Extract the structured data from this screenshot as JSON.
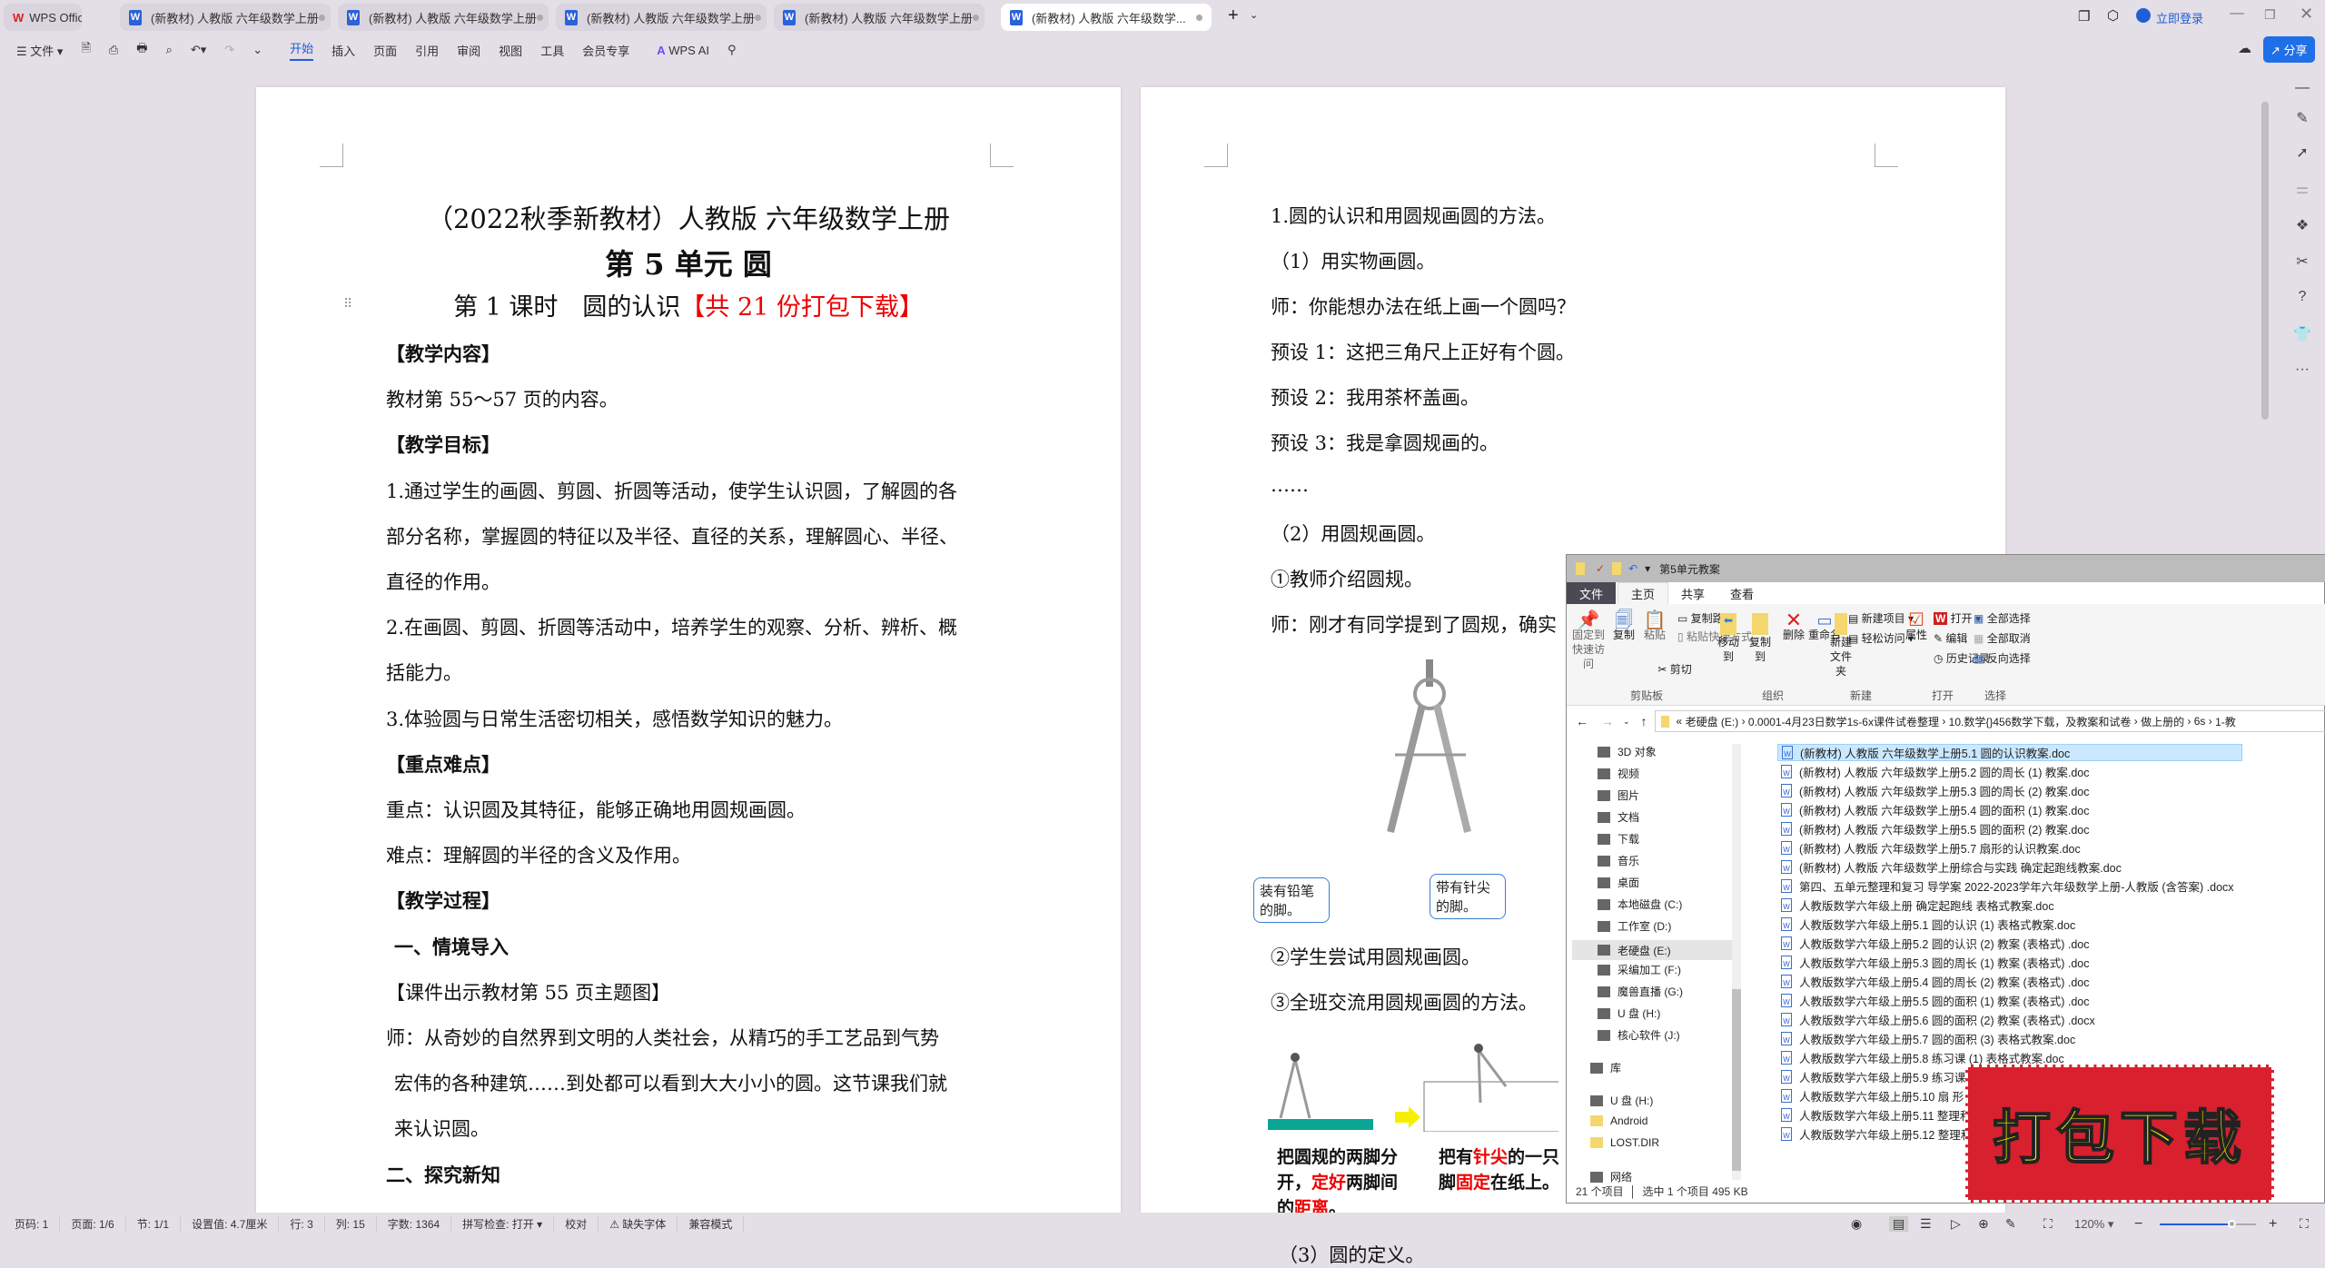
{
  "app": {
    "name": "WPS Office",
    "login": "立即登录",
    "share": "分享",
    "accent": "#1f5fd6"
  },
  "tabs": [
    {
      "label": "(新教材) 人教版 六年级数学上册"
    },
    {
      "label": "(新教材) 人教版 六年级数学上册"
    },
    {
      "label": "(新教材) 人教版 六年级数学上册"
    },
    {
      "label": "(新教材) 人教版 六年级数学上册"
    },
    {
      "label": "(新教材) 人教版 六年级数学..."
    }
  ],
  "toolbar": {
    "file": "文件",
    "menus": [
      "开始",
      "插入",
      "页面",
      "引用",
      "审阅",
      "视图",
      "工具",
      "会员专享"
    ],
    "ai": "WPS AI",
    "active": "开始"
  },
  "page1": {
    "title1": "（2022秋季新教材）人教版 六年级数学上册",
    "title2": "第 5 单元  圆",
    "title3a": "第 1 课时　圆的认识",
    "title3b": "【共 21 份打包下载】",
    "lines": [
      "【教学内容】",
      "教材第 55～57 页的内容。",
      "【教学目标】",
      "1.通过学生的画圆、剪圆、折圆等活动，使学生认识圆，了解圆的各",
      "部分名称，掌握圆的特征以及半径、直径的关系，理解圆心、半径、",
      "直径的作用。",
      "2.在画圆、剪圆、折圆等活动中，培养学生的观察、分析、辨析、概",
      "括能力。",
      "3.体验圆与日常生活密切相关，感悟数学知识的魅力。",
      "【重点难点】",
      "重点：认识圆及其特征，能够正确地用圆规画圆。",
      "难点：理解圆的半径的含义及作用。",
      "【教学过程】",
      "一、情境导入",
      "【课件出示教材第 55 页主题图】",
      "师：从奇妙的自然界到文明的人类社会，从精巧的手工艺品到气势",
      "宏伟的各种建筑……到处都可以看到大大小小的圆。这节课我们就",
      "来认识圆。",
      "二、探究新知"
    ]
  },
  "page2": {
    "lines": [
      "1.圆的认识和用圆规画圆的方法。",
      "（1）用实物画圆。",
      "师：你能想办法在纸上画一个圆吗？",
      "预设 1：这把三角尺上正好有个圆。",
      "预设 2：我用茶杯盖画。",
      "预设 3：我是拿圆规画的。",
      "……",
      "（2）用圆规画圆。",
      "①教师介绍圆规。",
      "师：刚才有同学提到了圆规，确实"
    ],
    "callout_left": "装有铅笔的脚。",
    "callout_right": "带有针尖的脚。",
    "step2": "②学生尝试用圆规画圆。",
    "step3": "③全班交流用圆规画圆的方法。",
    "cap1a": "把圆规的两脚分",
    "cap1b": "开，",
    "cap1c": "定好",
    "cap1d": "两脚间",
    "cap1e": "的",
    "cap1f": "距离",
    "cap1g": "。",
    "cap2a": "把有",
    "cap2b": "针尖",
    "cap2c": "的一只",
    "cap2d": "脚",
    "cap2e": "固定",
    "cap2f": "在纸上。",
    "def": "（3）圆的定义。"
  },
  "explorer": {
    "title": "第5单元教案",
    "tabs": [
      "文件",
      "主页",
      "共享",
      "查看"
    ],
    "ribbon": {
      "pin": "固定到快速访问",
      "copy": "复制",
      "paste": "粘贴",
      "copy_path": "复制路径",
      "paste_shortcut": "粘贴快捷方式",
      "cut": "剪切",
      "clipboard": "剪贴板",
      "move_to": "移动到",
      "copy_to": "复制到",
      "delete": "删除",
      "rename": "重命名",
      "organize": "组织",
      "new_folder": "新建文件夹",
      "new_item": "新建项目",
      "easy_access": "轻松访问",
      "new": "新建",
      "properties": "属性",
      "open": "打开",
      "edit": "编辑",
      "history": "历史记录",
      "open_group": "打开",
      "select_all": "全部选择",
      "select_none": "全部取消",
      "invert": "反向选择",
      "select": "选择"
    },
    "path": [
      "老硬盘 (E:)",
      "0.0001-4月23日数学1s-6x课件试卷整理",
      "10.数学{}456数学下载，及教案和试卷",
      "做上册的",
      "6s",
      "1-教"
    ],
    "nav": [
      "3D 对象",
      "视频",
      "图片",
      "文档",
      "下载",
      "音乐",
      "桌面",
      "本地磁盘 (C:)",
      "工作室 (D:)",
      "老硬盘 (E:)",
      "采编加工 (F:)",
      "魔兽直播 (G:)",
      "U 盘 (H:)",
      "核心软件 (J:)",
      "库",
      "U 盘 (H:)",
      "Android",
      "LOST.DIR",
      "网络"
    ],
    "nav_selected": "老硬盘 (E:)",
    "files": [
      "(新教材) 人教版 六年级数学上册5.1  圆的认识教案.doc",
      "(新教材) 人教版 六年级数学上册5.2  圆的周长 (1) 教案.doc",
      "(新教材) 人教版 六年级数学上册5.3  圆的周长 (2) 教案.doc",
      "(新教材) 人教版 六年级数学上册5.4  圆的面积 (1) 教案.doc",
      "(新教材) 人教版 六年级数学上册5.5  圆的面积 (2) 教案.doc",
      "(新教材) 人教版 六年级数学上册5.7  扇形的认识教案.doc",
      "(新教材) 人教版 六年级数学上册综合与实践  确定起跑线教案.doc",
      "第四、五单元整理和复习 导学案 2022-2023学年六年级数学上册-人教版 (含答案) .docx",
      "人教版数学六年级上册 确定起跑线 表格式教案.doc",
      "人教版数学六年级上册5.1 圆的认识 (1)  表格式教案.doc",
      "人教版数学六年级上册5.2 圆的认识 (2)  教案 (表格式) .doc",
      "人教版数学六年级上册5.3 圆的周长 (1)  教案 (表格式) .doc",
      "人教版数学六年级上册5.4 圆的周长 (2)  教案 (表格式) .doc",
      "人教版数学六年级上册5.5 圆的面积 (1)  教案 (表格式) .doc",
      "人教版数学六年级上册5.6 圆的面积 (2)  教案 (表格式) .docx",
      "人教版数学六年级上册5.7 圆的面积 (3)  表格式教案.doc",
      "人教版数学六年级上册5.8 练习课 (1)  表格式教案.doc",
      "人教版数学六年级上册5.9 练习课 (2)  表格式教案",
      "人教版数学六年级上册5.10 扇 形 表格",
      "人教版数学六年级上册5.11 整理和复习",
      "人教版数学六年级上册5.12 整理和复习"
    ],
    "selected_file": 0,
    "count": "21 个项目",
    "selection": "选中 1 个项目  495 KB"
  },
  "stamp": {
    "text": "打包下载",
    "bg": "#d8202f",
    "fg": "#f5f000"
  },
  "status": {
    "items": [
      "页码: 1",
      "页面: 1/6",
      "节: 1/1",
      "设置值: 4.7厘米",
      "行: 3",
      "列: 15",
      "字数: 1364",
      "拼写检查: 打开 ▾",
      "校对",
      "⚠ 缺失字体",
      "兼容模式"
    ],
    "zoom": "120%",
    "zoom_percent": 120
  }
}
